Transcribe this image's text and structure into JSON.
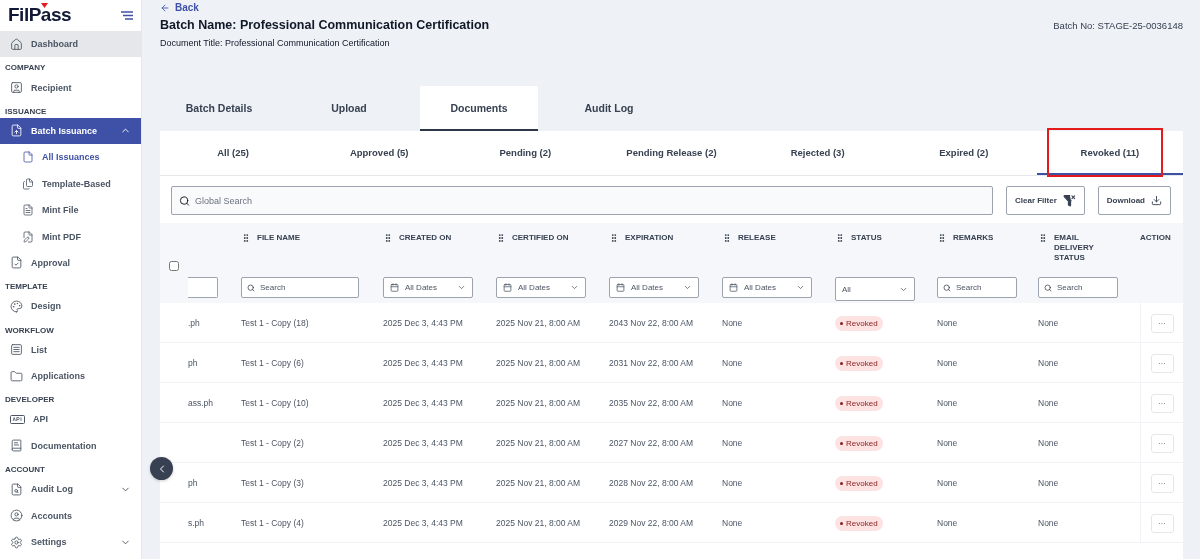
{
  "sidebar": {
    "logo": "FilPass",
    "groups": [
      {
        "items": [
          {
            "label": "Dashboard",
            "selected": false,
            "highlighted": true
          }
        ]
      },
      {
        "heading": "COMPANY",
        "items": [
          {
            "label": "Recipient",
            "selected": false,
            "highlighted": false
          }
        ]
      },
      {
        "heading": "ISSUANCE",
        "items": [
          {
            "label": "Batch Issuance",
            "selected": true,
            "highlighted": false,
            "expanded": true,
            "children": [
              {
                "label": "All Issuances",
                "selected": true
              },
              {
                "label": "Template-Based",
                "selected": false
              },
              {
                "label": "Mint File",
                "selected": false
              },
              {
                "label": "Mint PDF",
                "selected": false
              }
            ]
          },
          {
            "label": "Approval",
            "selected": false,
            "highlighted": false
          }
        ]
      },
      {
        "heading": "TEMPLATE",
        "items": [
          {
            "label": "Design",
            "selected": false,
            "highlighted": false
          }
        ]
      },
      {
        "heading": "WORKFLOW",
        "items": [
          {
            "label": "List",
            "selected": false,
            "highlighted": false
          },
          {
            "label": "Applications",
            "selected": false,
            "highlighted": false
          }
        ]
      },
      {
        "heading": "DEVELOPER",
        "items": [
          {
            "label": "API",
            "selected": false,
            "highlighted": false
          },
          {
            "label": "Documentation",
            "selected": false,
            "highlighted": false
          }
        ]
      },
      {
        "heading": "ACCOUNT",
        "items": [
          {
            "label": "Audit Log",
            "selected": false,
            "highlighted": false,
            "expanded": false
          },
          {
            "label": "Accounts",
            "selected": false,
            "highlighted": false
          },
          {
            "label": "Settings",
            "selected": false,
            "highlighted": false,
            "expanded": false
          }
        ]
      }
    ]
  },
  "header": {
    "back": "Back",
    "batch_name": "Batch Name: Professional Communication Certification",
    "document_title": "Document Title: Professional Communication Certification",
    "batch_no": "Batch No: STAGE-25-0036148"
  },
  "tabs": [
    {
      "label": "Batch Details",
      "selected": false
    },
    {
      "label": "Upload",
      "selected": false
    },
    {
      "label": "Documents",
      "selected": true
    },
    {
      "label": "Audit Log",
      "selected": false
    }
  ],
  "status_tabs": [
    {
      "label": "All (25)",
      "selected": false,
      "highlighted": false
    },
    {
      "label": "Approved (5)",
      "selected": false,
      "highlighted": false
    },
    {
      "label": "Pending (2)",
      "selected": false,
      "highlighted": false
    },
    {
      "label": "Pending Release (2)",
      "selected": false,
      "highlighted": false
    },
    {
      "label": "Rejected (3)",
      "selected": false,
      "highlighted": false
    },
    {
      "label": "Expired (2)",
      "selected": false,
      "highlighted": false
    },
    {
      "label": "Revoked (11)",
      "selected": true,
      "highlighted": true
    }
  ],
  "toolbar": {
    "search": {
      "placeholder": "Global Search"
    },
    "buttons": [
      "Clear Filter",
      "Download"
    ]
  },
  "table": {
    "columns": [
      {
        "kind": "text",
        "filter": {
          "kind": "text"
        }
      },
      {
        "kind": "text",
        "label": "FILE NAME",
        "filter": {
          "kind": "text",
          "placeholder": "Search"
        }
      },
      {
        "kind": "text",
        "label": "CREATED ON",
        "filter": {
          "kind": "date",
          "value": "All Dates"
        }
      },
      {
        "kind": "text",
        "label": "CERTIFIED ON",
        "filter": {
          "kind": "date",
          "value": "All Dates"
        }
      },
      {
        "kind": "text",
        "label": "EXPIRATION",
        "filter": {
          "kind": "date",
          "value": "All Dates"
        }
      },
      {
        "kind": "text",
        "label": "RELEASE",
        "filter": {
          "kind": "date",
          "value": "All Dates"
        }
      },
      {
        "kind": "status",
        "label": "STATUS",
        "filter": {
          "kind": "select",
          "value": "All"
        }
      },
      {
        "kind": "text",
        "label": "REMARKS",
        "filter": {
          "kind": "text",
          "placeholder": "Search"
        }
      },
      {
        "kind": "text",
        "label": "EMAIL DELIVERY STATUS",
        "filter": {
          "kind": "text",
          "placeholder": "Search"
        }
      },
      {
        "kind": "action",
        "label": "ACTION"
      }
    ],
    "all_checked": false,
    "rows": [
      {
        "cells": [
          ".ph",
          "Test 1 - Copy (18)",
          "2025 Dec 3, 4:43 PM",
          "2025 Nov 21, 8:00 AM",
          "2043 Nov 22, 8:00 AM",
          "None",
          "Revoked",
          "None",
          "None",
          "···"
        ]
      },
      {
        "cells": [
          "ph",
          "Test 1 - Copy (6)",
          "2025 Dec 3, 4:43 PM",
          "2025 Nov 21, 8:00 AM",
          "2031 Nov 22, 8:00 AM",
          "None",
          "Revoked",
          "None",
          "None",
          "···"
        ]
      },
      {
        "cells": [
          "ass.ph",
          "Test 1 - Copy (10)",
          "2025 Dec 3, 4:43 PM",
          "2025 Nov 21, 8:00 AM",
          "2035 Nov 22, 8:00 AM",
          "None",
          "Revoked",
          "None",
          "None",
          "···"
        ]
      },
      {
        "cells": [
          null,
          "Test 1 - Copy (2)",
          "2025 Dec 3, 4:43 PM",
          "2025 Nov 21, 8:00 AM",
          "2027 Nov 22, 8:00 AM",
          "None",
          "Revoked",
          "None",
          "None",
          "···"
        ]
      },
      {
        "cells": [
          "ph",
          "Test 1 - Copy (3)",
          "2025 Dec 3, 4:43 PM",
          "2025 Nov 21, 8:00 AM",
          "2028 Nov 22, 8:00 AM",
          "None",
          "Revoked",
          "None",
          "None",
          "···"
        ]
      },
      {
        "cells": [
          "s.ph",
          "Test 1 - Copy (4)",
          "2025 Dec 3, 4:43 PM",
          "2025 Nov 21, 8:00 AM",
          "2029 Nov 22, 8:00 AM",
          "None",
          "Revoked",
          "None",
          "None",
          "···"
        ]
      }
    ]
  }
}
